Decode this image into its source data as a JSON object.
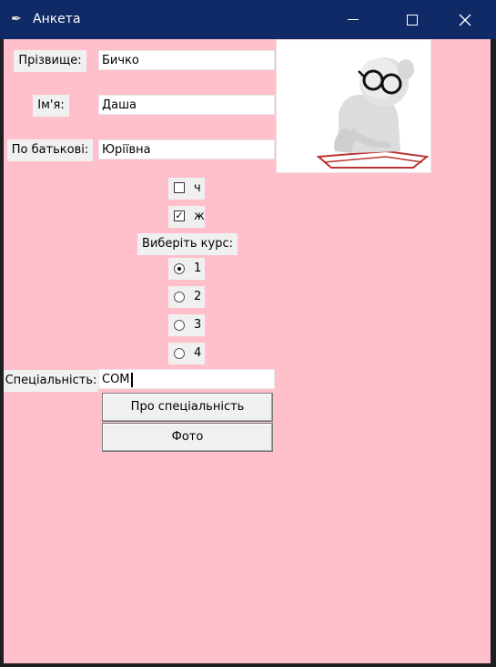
{
  "window": {
    "title": "Анкета",
    "minimize_glyph": "—",
    "maximize_glyph": "☐",
    "close_glyph": "✕",
    "app_icon": "feather-icon",
    "colors": {
      "titlebar": "#0f2a66",
      "background": "#ffc0cb"
    }
  },
  "form": {
    "surname_label": "Прізвище:",
    "surname_value": "Бичко",
    "name_label": "Ім'я:",
    "name_value": "Даша",
    "patronymic_label": "По батькові:",
    "patronymic_value": "Юріївна",
    "gender": [
      {
        "label": "ч",
        "checked": false
      },
      {
        "label": "ж",
        "checked": true
      }
    ],
    "course_label": "Виберіть курс:",
    "courses": [
      {
        "label": "1",
        "selected": true
      },
      {
        "label": "2",
        "selected": false
      },
      {
        "label": "3",
        "selected": false
      },
      {
        "label": "4",
        "selected": false
      }
    ],
    "specialty_label": "Спеціальність:",
    "specialty_value": "COM",
    "about_button": "Про спеціальність",
    "photo_button": "Фото",
    "photo": "person-reading-icon"
  }
}
